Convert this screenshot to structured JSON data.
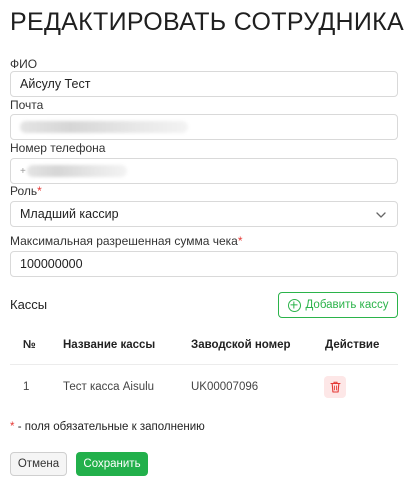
{
  "page": {
    "title": "РЕДАКТИРОВАТЬ СОТРУДНИКА"
  },
  "form": {
    "fio_label": "ФИО",
    "fio_value": "Айсулу Тест",
    "email_label": "Почта",
    "phone_label": "Номер телефона",
    "phone_prefix": "+",
    "role_label": "Роль",
    "role_value": "Младший кассир",
    "max_sum_label": "Максимальная разрешенная сумма чека",
    "max_sum_value": "100000000",
    "required_mark": "*"
  },
  "cashboxes": {
    "section_title": "Кассы",
    "add_button": "Добавить кассу",
    "columns": [
      "№",
      "Название кассы",
      "Заводской номер",
      "Действие"
    ],
    "rows": [
      {
        "num": "1",
        "name": "Тест касса Aisulu",
        "serial": "UK00007096"
      }
    ]
  },
  "footer": {
    "required_note": "- поля обязательные к заполнению",
    "cancel_button": "Отмена",
    "save_button": "Сохранить"
  },
  "colors": {
    "accent": "#22b04b",
    "danger": "#e53935",
    "danger_bg": "#fde7e7"
  },
  "icons": {
    "add": "plus-circle-icon",
    "delete": "trash-icon",
    "select": "chevron-down-icon"
  }
}
